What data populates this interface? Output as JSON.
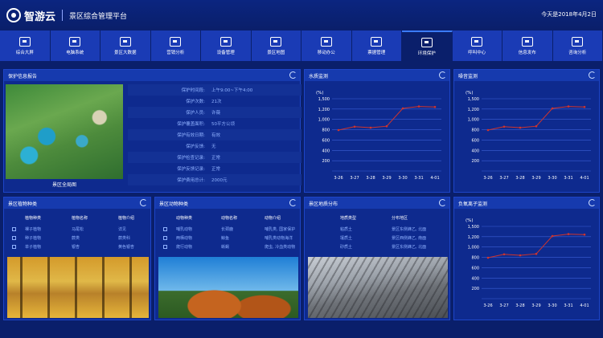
{
  "header": {
    "logo_text": "智游云",
    "app_title": "景区综合管理平台",
    "date_text": "今天是2018年4月2日"
  },
  "nav": [
    {
      "label": "综合大屏",
      "icon": "screen-icon"
    },
    {
      "label": "电脑系统",
      "icon": "computer-icon"
    },
    {
      "label": "景区大数据",
      "icon": "data-icon"
    },
    {
      "label": "营销分析",
      "icon": "analysis-icon"
    },
    {
      "label": "设备管理",
      "icon": "device-icon"
    },
    {
      "label": "景区地图",
      "icon": "map-icon"
    },
    {
      "label": "移动办公",
      "icon": "mobile-icon"
    },
    {
      "label": "票据管理",
      "icon": "ticket-icon"
    },
    {
      "label": "环境保护",
      "icon": "environment-icon"
    },
    {
      "label": "呼叫中心",
      "icon": "call-icon"
    },
    {
      "label": "信息发布",
      "icon": "publish-icon"
    },
    {
      "label": "咨询分析",
      "icon": "consult-icon"
    }
  ],
  "panels": {
    "protection": {
      "title": "保护信息报告",
      "photo_caption": "景区全局图",
      "rows": [
        {
          "label": "保护时间段:",
          "value": "上午9:00~下午4:00"
        },
        {
          "label": "保护次数:",
          "value": "21次"
        },
        {
          "label": "保护人员:",
          "value": "许薇"
        },
        {
          "label": "保护覆盖面积:",
          "value": "50平方公顷"
        },
        {
          "label": "保护有效日期:",
          "value": "有效"
        },
        {
          "label": "保护反馈:",
          "value": "无"
        },
        {
          "label": "保护检查记录:",
          "value": "正常"
        },
        {
          "label": "保护反馈记录:",
          "value": "正常"
        },
        {
          "label": "保护费用总计:",
          "value": "2000元"
        }
      ]
    },
    "plants": {
      "title": "景区植物种类",
      "headers": [
        "植物种类",
        "植物名称",
        "植物介绍"
      ],
      "rows": [
        [
          "裸子植物",
          "马尾松",
          "详见"
        ],
        [
          "种子植物",
          "蕨类",
          "蕨类科"
        ],
        [
          "单子植物",
          "银杏",
          "黄色银杏"
        ]
      ]
    },
    "animals": {
      "title": "景区动物种类",
      "headers": [
        "动物种类",
        "动物名称",
        "动物介绍"
      ],
      "rows": [
        [
          "哺乳动物",
          "长颈鹿",
          "哺乳类, 国家保护"
        ],
        [
          "两栖动物",
          "鲸鱼",
          "哺乳类动物海洋"
        ],
        [
          "爬行动物",
          "蜥蜴",
          "爬虫, 冷血类动物"
        ]
      ]
    },
    "soil": {
      "title": "景区地质分布",
      "headers": [
        "地质类型",
        "分布地区"
      ],
      "rows": [
        [
          "粘质土",
          "景区东侧蜂乙, 北面"
        ],
        [
          "壤质土",
          "景区西侧蜂乙, 南面"
        ],
        [
          "砂质土",
          "景区东侧蜂乙, 北面"
        ]
      ]
    }
  },
  "chart_data": [
    {
      "type": "line",
      "title": "水质监测",
      "ylabel": "(%)",
      "x": [
        "3-26",
        "3-27",
        "3-28",
        "3-29",
        "3-30",
        "3-31",
        "4-01"
      ],
      "series": [
        {
          "values": [
            850,
            920,
            900,
            930,
            1300,
            1340,
            1330
          ]
        }
      ],
      "yticks": [
        "",
        "200",
        "400",
        "600",
        "800",
        "1,000",
        "1,200",
        "1,500"
      ],
      "ylim": [
        0,
        1500
      ],
      "grid": true
    },
    {
      "type": "line",
      "title": "噪音监测",
      "ylabel": "(%)",
      "x": [
        "3-26",
        "3-27",
        "3-28",
        "3-29",
        "3-30",
        "3-31",
        "4-01"
      ],
      "series": [
        {
          "values": [
            850,
            920,
            900,
            930,
            1300,
            1340,
            1330
          ]
        }
      ],
      "yticks": [
        "",
        "200",
        "400",
        "600",
        "800",
        "1,000",
        "1,200",
        "1,500"
      ],
      "ylim": [
        0,
        1500
      ],
      "grid": true
    },
    {
      "type": "line",
      "title": "负氧离子监测",
      "ylabel": "(%)",
      "x": [
        "3-26",
        "3-27",
        "3-28",
        "3-29",
        "3-30",
        "3-31",
        "4-01"
      ],
      "series": [
        {
          "values": [
            850,
            920,
            900,
            930,
            1300,
            1340,
            1330
          ]
        }
      ],
      "yticks": [
        "",
        "200",
        "400",
        "600",
        "800",
        "1,000",
        "1,200",
        "1,500"
      ],
      "ylim": [
        0,
        1500
      ],
      "grid": true
    }
  ],
  "colors": {
    "background": "#0a1f6b",
    "panel": "#0e2a8e",
    "nav": "#1a3bb5",
    "line": "#d0342c"
  }
}
